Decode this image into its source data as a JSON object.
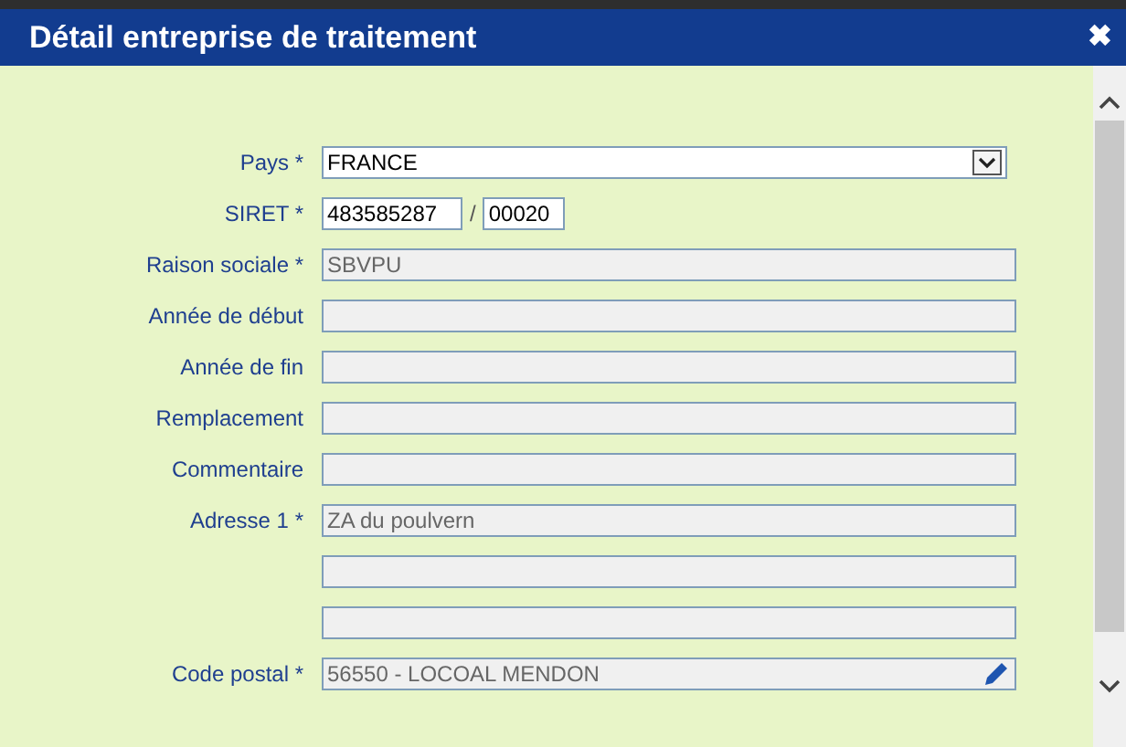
{
  "window": {
    "title": "Détail entreprise de traitement",
    "close": "✖"
  },
  "fields": [
    {
      "kind": "select",
      "label": "Pays *",
      "value": "FRANCE",
      "disabled": false
    },
    {
      "kind": "siret",
      "label": "SIRET *",
      "value": "483585287",
      "separator": "/",
      "value_2": "00020",
      "disabled": false
    },
    {
      "kind": "text",
      "label": "Raison sociale *",
      "value": "SBVPU",
      "disabled": true
    },
    {
      "kind": "text",
      "label": "Année de début",
      "disabled": true
    },
    {
      "kind": "text",
      "label": "Année de fin",
      "disabled": true
    },
    {
      "kind": "text",
      "label": "Remplacement",
      "disabled": true
    },
    {
      "kind": "text",
      "label": "Commentaire",
      "disabled": true
    },
    {
      "kind": "text",
      "label": "Adresse 1 *",
      "value": "ZA du poulvern",
      "disabled": true
    },
    {
      "kind": "text",
      "disabled": true
    },
    {
      "kind": "text",
      "disabled": true
    },
    {
      "kind": "lookup",
      "label": "Code postal *",
      "value": "56550 - LOCOAL MENDON",
      "disabled": true
    }
  ]
}
